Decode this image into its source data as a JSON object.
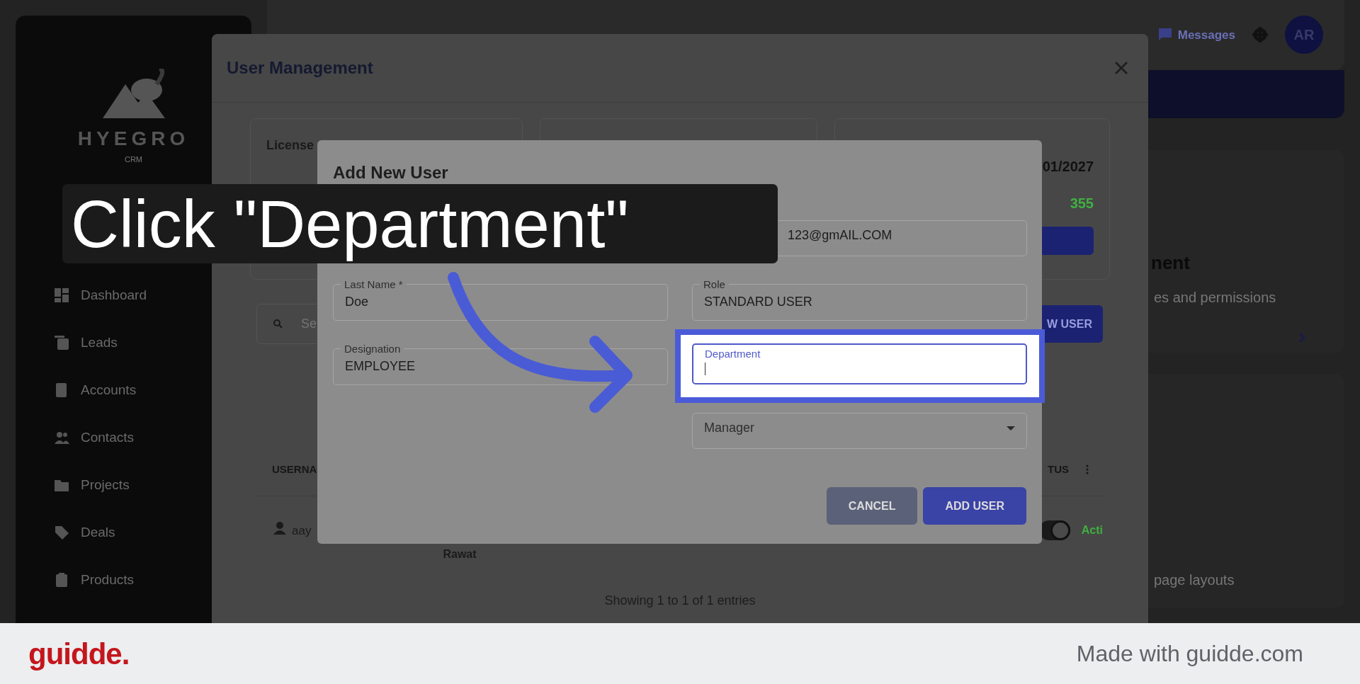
{
  "sidebar": {
    "brand": "HYEGRO",
    "brand_sub": "CRM",
    "items": [
      {
        "label": "Dashboard"
      },
      {
        "label": "Leads"
      },
      {
        "label": "Accounts"
      },
      {
        "label": "Contacts"
      },
      {
        "label": "Projects"
      },
      {
        "label": "Deals"
      },
      {
        "label": "Products"
      }
    ]
  },
  "topbar": {
    "messages": "Messages",
    "avatar": "AR"
  },
  "background_cards": [
    {
      "title": "nent",
      "subtitle": "es and permissions"
    },
    {
      "subtitle": "page layouts"
    }
  ],
  "user_management": {
    "title": "User Management",
    "license_card": {
      "heading": "License"
    },
    "expiration_card": {
      "date": "01/2027",
      "count": "355"
    },
    "search": {
      "placeholder": "Se"
    },
    "new_user_button": "W USER",
    "table": {
      "columns": [
        "USERNA",
        "TUS"
      ],
      "rows": [
        {
          "username": "aay",
          "name": "Rawat",
          "active": true,
          "status": "Acti"
        }
      ]
    },
    "footer": "Showing 1 to 1 of 1 entries"
  },
  "add_user": {
    "title": "Add New User",
    "fields": [
      {
        "kind": "text",
        "second_column": true,
        "value": "123@gmAIL.COM",
        "focused": false
      },
      {
        "kind": "text",
        "second_column": false,
        "label": "Last Name *",
        "value": "Doe",
        "focused": false
      },
      {
        "kind": "text",
        "second_column": true,
        "label": "Role",
        "value": "STANDARD USER",
        "focused": false
      },
      {
        "kind": "text",
        "second_column": false,
        "label": "Designation",
        "value": "EMPLOYEE",
        "focused": false
      },
      {
        "kind": "text",
        "second_column": true,
        "label": "Department",
        "focused": true
      },
      {
        "kind": "select",
        "placeholder": "Manager",
        "focused": false
      }
    ],
    "buttons": [
      {
        "label": "CANCEL",
        "kind": "secondary"
      },
      {
        "label": "ADD USER",
        "kind": "primary"
      }
    ]
  },
  "caption": "Click \"Department\"",
  "footer_banner": {
    "logo": "guidde.",
    "credit": "Made with guidde.com"
  }
}
